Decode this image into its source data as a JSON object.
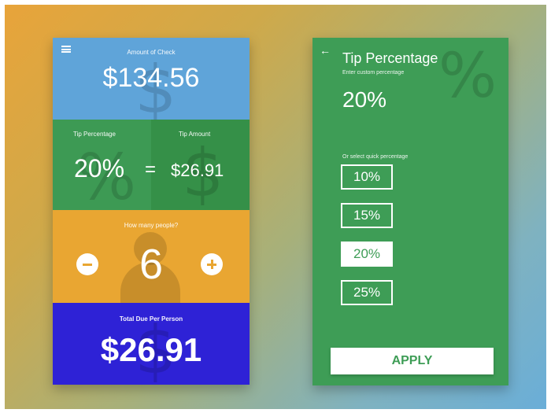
{
  "left_screen": {
    "amount": {
      "label": "Amount of Check",
      "value": "$134.56"
    },
    "tip": {
      "percent_label": "Tip Percentage",
      "percent_value": "20%",
      "equals": "=",
      "amount_label": "Tip Amount",
      "amount_value": "$26.91"
    },
    "people": {
      "label": "How many people?",
      "count": "6"
    },
    "total": {
      "label": "Total Due Per Person",
      "value": "$26.91"
    }
  },
  "right_screen": {
    "title": "Tip Percentage",
    "custom_prompt": "Enter custom percentage",
    "custom_value": "20%",
    "quick_prompt": "Or select quick percentage",
    "options": [
      {
        "label": "10%",
        "selected": false
      },
      {
        "label": "15%",
        "selected": false
      },
      {
        "label": "20%",
        "selected": true
      },
      {
        "label": "25%",
        "selected": false
      }
    ],
    "apply_label": "APPLY"
  },
  "icons": {
    "menu": "hamburger-menu-icon",
    "back": "back-arrow-icon",
    "minus": "minus-icon",
    "plus": "plus-icon",
    "person": "person-icon"
  },
  "colors": {
    "amount_blue": "#5fa4d9",
    "tip_green": "#3d9a54",
    "people_orange": "#e9a632",
    "total_indigo": "#2e22d6",
    "screen_green": "#3e9d56"
  }
}
